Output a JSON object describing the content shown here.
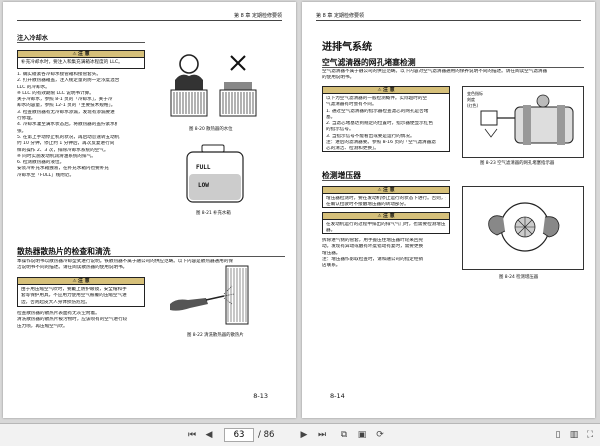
{
  "viewer": {
    "current_page": "63",
    "total_pages": "/ 86",
    "icons": [
      "first-page-icon",
      "prev-page-icon",
      "next-page-icon",
      "last-page-icon",
      "dual-page-icon",
      "continuous-page-icon",
      "rotate-icon",
      "single-page-icon",
      "two-page-view-icon",
      "fullscreen-icon"
    ]
  },
  "left_page": {
    "running_head": "第 8 章 定期检修要领",
    "section_title": "注入冷却水",
    "notice1": {
      "label": "注 意",
      "text": "补充冷却水时，要注入和集充满箱冰程度的 LLC。"
    },
    "steps": [
      "1. 确实碰紧各冷却水接管箱和接管套头。",
      "2. 打开散热器箱盖，注入规定量的防一定浓度混合",
      "   LLC 的冷却水。",
      "※ LLC 的有效期限 LLC 说明书计算。",
      "   关于冷却水，参照 8-1 页的「冷却水」，关于冷",
      "   却水的容量，参照 12-1 页的「主要技术规格」。",
      "3. 检查散热器有无冷却水渗漏，发现有渗漏要进",
      "   行修理。",
      "4. 冷却水灌至满水状态后，将散热器的盖拧紧水扩",
      "   张。",
      "5. 在第上手动停止机的状况，再启动怠速转五动机",
      "   约 10 分钟，停止约 1 分钟后，再次反复进行同",
      "   样的操作 2、3 次，排除冷却水系统的空气。",
      "※ 同时实施发动机润滑油系统的排气。",
      "6. 检测散热器的液位。",
      "   安装冷补充水箱独液，在补充水箱内也要补充",
      "   冷却水至「FULL」线附近。"
    ],
    "fig1_caption": "图 8-20 散热器的水位",
    "fig2_caption": "图 8-21 补充水箱",
    "tank_labels": [
      "FULL",
      "LOW"
    ],
    "section2_title": "散热器散热片的检查和清洗",
    "section2_text": [
      "本操作说明书以散热器冷却型式进行说明。铁散热器不属于融公司的供应范畴。以下内容是散热器通用的保",
      "洁说明书不同的描述。请在阅读散热器的使用说明书。"
    ],
    "notice2": {
      "label": "注 意",
      "lines": [
        "由于用压缩空气吹时，要戴上防护眼镜，安全帽和手",
        "套等保护用具，不应用力使用空气被覆的压缩空气进",
        "边，否则起皮大人身体损伤危险。"
      ]
    },
    "after_notice": [
      "检查散热器的散热片表面有无灰尘附着。",
      "清洗散热器的散热片被污物时，应该喷有的空气进行较",
      "压力喷，再压缩空气吹。"
    ],
    "fig3_caption": "图 8-22 清洗散热器的散热片",
    "page_number": "8-13"
  },
  "right_page": {
    "running_head": "第 8 章 定期检修要领",
    "page_title": "进排气系统",
    "section1_title": "空气滤清器的网孔堵塞检测",
    "section1_text": [
      "空气滤清器不属于融公司的供应范畴。以下内容对空气滤清器通用的保养说明不同的描述。请在阅读空气滤清器",
      "的使用说明书。"
    ],
    "notice1": {
      "label": "注 意",
      "lines": [
        "以下为空气滤清器的一般检测概件。实际超时的空",
        "气滤清器有时会有不同。",
        "1. 通过空气滤清器的指示器检查滤芯的网孔是否堵",
        "   塞。",
        "2. 当滤芯堵塞达到规定的位置时，指示器便显示红色",
        "   的指示信号。",
        "3. 当指示信号不能看出或要是运行的情况。",
        "注：进后的滤清器要。参照 8-16 页的「空气滤清器滤",
        "   芯的清洁、检测和更换」。"
      ]
    },
    "fig1_caption": "图 8-23 空气滤清器的网孔堵塞指示器",
    "fig1_labels": [
      "变色指标",
      "刻度",
      "(红色)"
    ],
    "section2_title": "检测增压器",
    "notice2": {
      "label": "注 意",
      "lines": [
        "增压器检测时，要在发动机停止运行的状态下进行。否则，要",
        "在确认拉驶时不接触增压器的转动部分。"
      ]
    },
    "notice3": {
      "label": "注 意",
      "lines": [
        "在发动机运行的过程中排出的排气气门时，也需要检测增压",
        "器。"
      ]
    },
    "after_notice": [
      "拆除进气侧的管套，用手握压住增压器叶轮来回晃",
      "动。发现有异动或触有坏度错动有复时，需要更换",
      "增压器。",
      "注：增压器作影取检查时，请和融公司的指定经销",
      "   店联系。"
    ],
    "fig2_caption": "图 8-24 检测增压器",
    "page_number": "8-14"
  }
}
